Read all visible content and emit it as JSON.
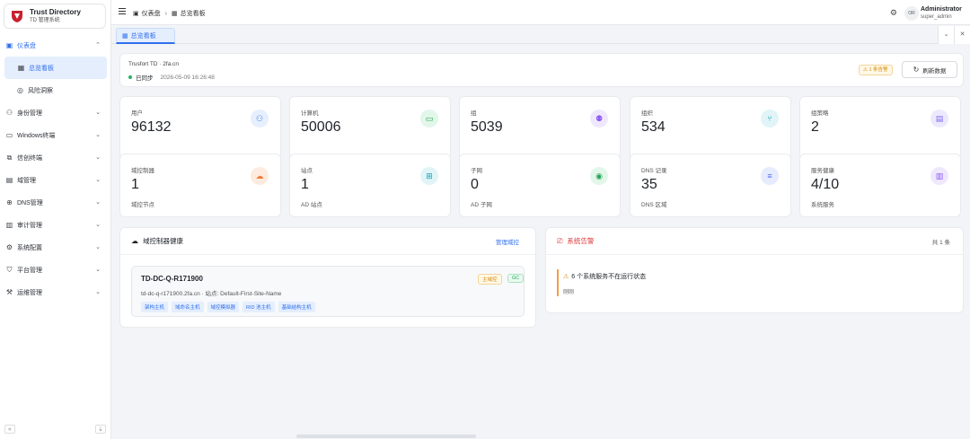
{
  "brand": {
    "title": "Trust Directory",
    "subtitle": "TD 管理系统"
  },
  "sidebar": {
    "items": [
      {
        "label": "仪表盘",
        "icon": "dashboard-icon",
        "expanded": true
      },
      {
        "label": "总览看板",
        "icon": "",
        "active": true
      },
      {
        "label": "风险洞察",
        "icon": "radar-icon"
      },
      {
        "label": "身份管理",
        "icon": "user-icon"
      },
      {
        "label": "Windows终端",
        "icon": "monitor-icon"
      },
      {
        "label": "信创终端",
        "icon": "chat-monitor-icon"
      },
      {
        "label": "域管理",
        "icon": "server-icon"
      },
      {
        "label": "DNS管理",
        "icon": "globe-icon"
      },
      {
        "label": "审计管理",
        "icon": "audit-icon"
      },
      {
        "label": "系统配置",
        "icon": "gear-icon"
      },
      {
        "label": "平台管理",
        "icon": "shield-icon"
      },
      {
        "label": "运维管理",
        "icon": "wrench-icon"
      }
    ],
    "collapse_glyph": "«",
    "pin_glyph": "⇣"
  },
  "header": {
    "breadcrumb": [
      "仪表盘",
      "总览看板"
    ],
    "user_initials": "OR",
    "user_name": "Administrator",
    "user_role": "super_admin"
  },
  "tabs": [
    {
      "label": "总览看板"
    }
  ],
  "info": {
    "title": "Trusfort TD · 2fa.cn",
    "status": "已同步",
    "time": "2026-05-09 16:26:48",
    "warn_badge": "⚠ 1 条告警",
    "refresh_label": "刷新数据"
  },
  "stats": [
    {
      "label": "用户",
      "value": "96132",
      "sub": "",
      "icon": "user-icon",
      "color": "#4f8cf0",
      "bg": "#e6effd"
    },
    {
      "label": "计算机",
      "value": "50006",
      "sub": "",
      "icon": "monitor-icon",
      "color": "#22a355",
      "bg": "#e3f6ea"
    },
    {
      "label": "组",
      "value": "5039",
      "sub": "",
      "icon": "group-icon",
      "color": "#8b5cf6",
      "bg": "#efe8fd"
    },
    {
      "label": "组织",
      "value": "534",
      "sub": "",
      "icon": "org-tree-icon",
      "color": "#14a3b8",
      "bg": "#e1f4f7"
    },
    {
      "label": "组策略",
      "value": "2",
      "sub": "",
      "icon": "policy-icon",
      "color": "#7c6cf0",
      "bg": "#ece9fc"
    },
    {
      "label": "域控制器",
      "value": "1",
      "sub": "域控节点",
      "icon": "cloud-icon",
      "color": "#ef7d3c",
      "bg": "#fdebdf"
    },
    {
      "label": "站点",
      "value": "1",
      "sub": "AD 站点",
      "icon": "sitemap-icon",
      "color": "#14a3b8",
      "bg": "#e1f4f7"
    },
    {
      "label": "子网",
      "value": "0",
      "sub": "AD 子网",
      "icon": "network-icon",
      "color": "#22a355",
      "bg": "#e3f6ea"
    },
    {
      "label": "DNS 记录",
      "value": "35",
      "sub": "DNS 区域",
      "icon": "list-icon",
      "color": "#4f6ef0",
      "bg": "#e6ebfd"
    },
    {
      "label": "服务健康",
      "value": "4/10",
      "sub": "系统服务",
      "icon": "server-icon",
      "color": "#8b5cf6",
      "bg": "#efe8fd"
    }
  ],
  "dc_panel": {
    "title": "域控制器健康",
    "link": "管理域控",
    "dc_name": "TD-DC-Q-R171900",
    "dc_meta": "td-dc-q-r171900.2fa.cn · 站点: Default-First-Site-Name",
    "badge_primary": "主域控",
    "badge_gc": "GC",
    "tags": [
      "架构主机",
      "域命名主机",
      "域控模拟器",
      "RID 池主机",
      "基础结构主机"
    ]
  },
  "alert_panel": {
    "title": "系统告警",
    "count": "共 1 条",
    "alert_title": "6 个系统服务不在运行状态",
    "alert_desc": "刚刚"
  }
}
